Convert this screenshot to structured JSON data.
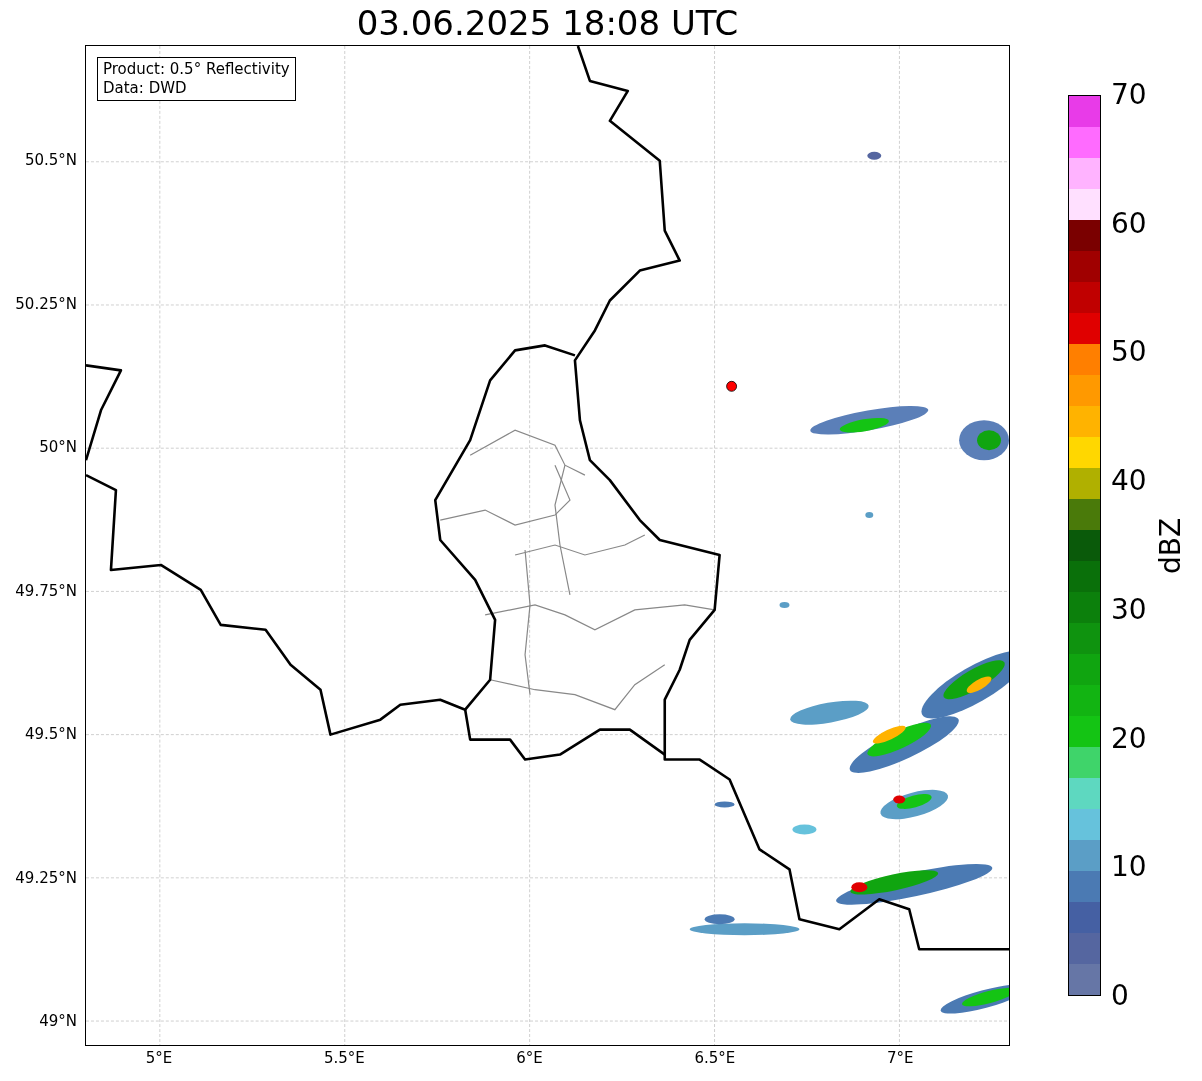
{
  "title": "03.06.2025 18:08 UTC",
  "info_box": [
    "Product: 0.5° Reflectivity",
    "Data: DWD"
  ],
  "lat_labels": [
    "50.5°N",
    "50.25°N",
    "50°N",
    "49.75°N",
    "49.5°N",
    "49.25°N",
    "49°N"
  ],
  "lon_labels": [
    "5°E",
    "5.5°E",
    "6°E",
    "6.5°E",
    "7°E"
  ],
  "colorbar": {
    "label": "dBZ",
    "ticks": [
      "70",
      "60",
      "50",
      "40",
      "30",
      "20",
      "10",
      "0"
    ],
    "segments": [
      {
        "color": "#6676a6"
      },
      {
        "color": "#5566a0"
      },
      {
        "color": "#4560a3"
      },
      {
        "color": "#4b7ab3"
      },
      {
        "color": "#5b9ec6"
      },
      {
        "color": "#66c2dc"
      },
      {
        "color": "#5ed8c0"
      },
      {
        "color": "#3fd46a"
      },
      {
        "color": "#14c414"
      },
      {
        "color": "#12b412"
      },
      {
        "color": "#10a510"
      },
      {
        "color": "#0f930f"
      },
      {
        "color": "#0c800c"
      },
      {
        "color": "#0a700a"
      },
      {
        "color": "#0a5a0a"
      },
      {
        "color": "#4a7a0a"
      },
      {
        "color": "#b0b000"
      },
      {
        "color": "#ffd700"
      },
      {
        "color": "#ffb300"
      },
      {
        "color": "#ff9900"
      },
      {
        "color": "#ff7f00"
      },
      {
        "color": "#e00000"
      },
      {
        "color": "#c00000"
      },
      {
        "color": "#a00000"
      },
      {
        "color": "#7a0000"
      },
      {
        "color": "#ffe0ff"
      },
      {
        "color": "#ffb3ff"
      },
      {
        "color": "#ff6bff"
      },
      {
        "color": "#e83be8"
      }
    ]
  }
}
